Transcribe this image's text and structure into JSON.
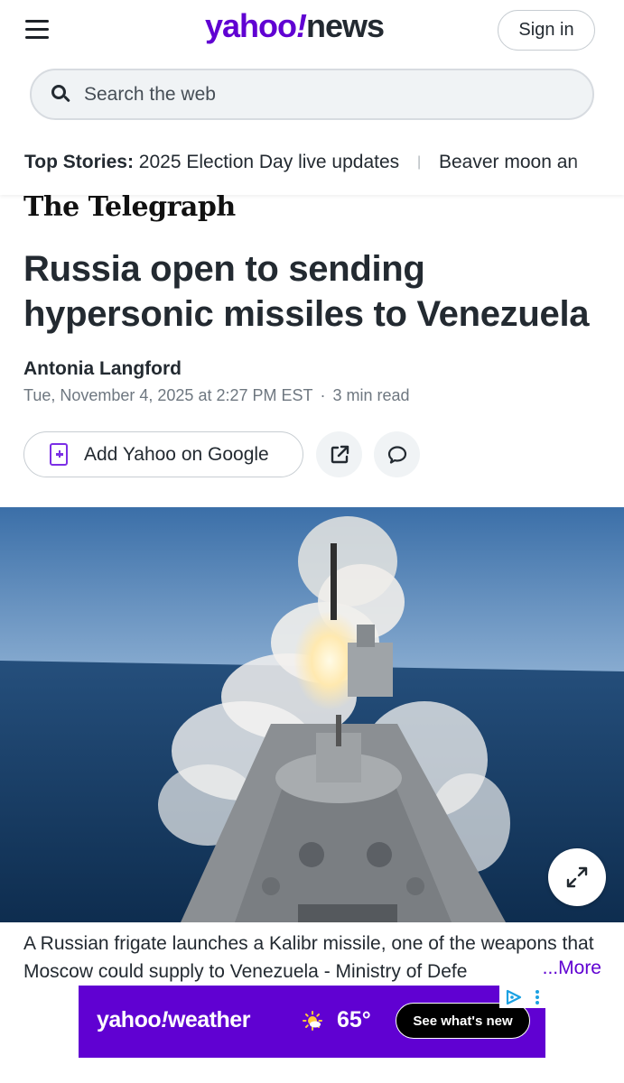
{
  "header": {
    "logo_main": "yahoo",
    "logo_bang": "!",
    "logo_section": "news",
    "signin_label": "Sign in",
    "search_placeholder": "Search the web"
  },
  "top_stories": {
    "label": "Top Stories:",
    "items": [
      "2025 Election Day live updates",
      "Beaver moon an"
    ]
  },
  "article": {
    "publisher": "The Telegraph",
    "headline": "Russia open to sending hypersonic missiles to Venezuela",
    "author": "Antonia Langford",
    "date": "Tue, November 4, 2025 at 2:27 PM EST",
    "dot": "·",
    "read_time": "3 min read",
    "add_google_label": "Add Yahoo on Google",
    "caption": "A Russian frigate launches a Kalibr missile, one of the weapons that Moscow could supply to Venezuela - Ministry of Defe",
    "caption_more": "...More"
  },
  "ad": {
    "logo_main": "yahoo",
    "logo_bang": "!",
    "logo_section": "weather",
    "temperature": "65°",
    "cta_label": "See what's new"
  },
  "colors": {
    "brand_purple": "#6001d2",
    "text_dark": "#232a31",
    "text_muted": "#6e7780",
    "search_bg": "#f0f3f5"
  },
  "icons": [
    "menu-icon",
    "search-icon",
    "add-document-icon",
    "share-icon",
    "comment-icon",
    "expand-icon",
    "sun-icon",
    "adchoices-icon"
  ]
}
